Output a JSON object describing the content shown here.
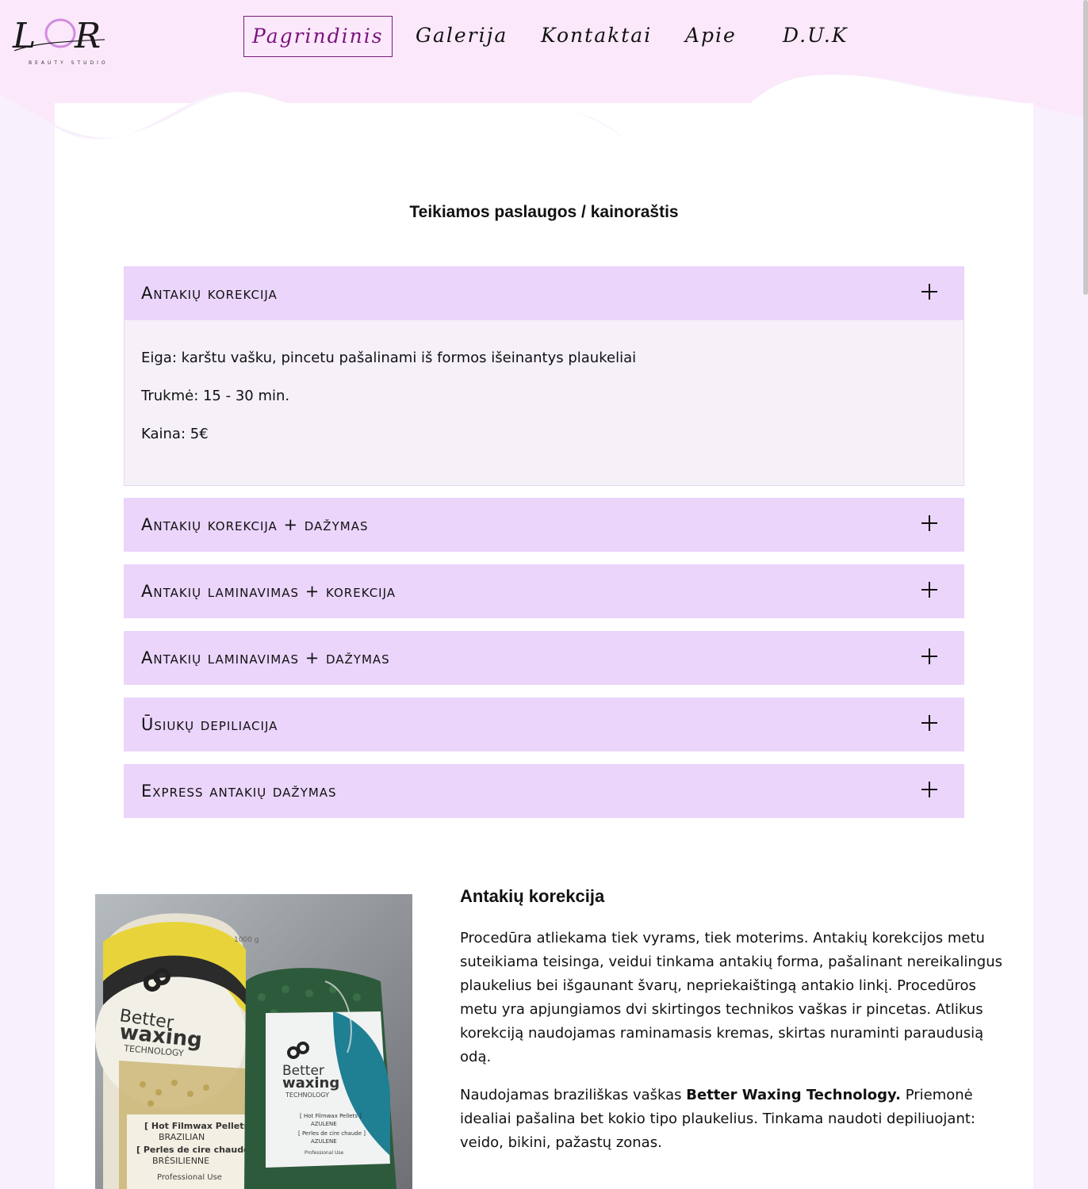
{
  "brand": {
    "logo_text": "LOR",
    "logo_sub": "BEAUTY STUDIO"
  },
  "nav": {
    "items": [
      {
        "label": "Pagrindinis",
        "active": true
      },
      {
        "label": "Galerija",
        "active": false
      },
      {
        "label": "Kontaktai",
        "active": false
      },
      {
        "label": "Apie",
        "active": false
      },
      {
        "label": "D.U.K",
        "active": false
      }
    ]
  },
  "services": {
    "title": "Teikiamos paslaugos / kainoraštis",
    "items": [
      {
        "label": "Antakių korekcija",
        "expanded": true,
        "details": [
          "Eiga: karštu vašku, pincetu pašalinami iš formos išeinantys plaukeliai",
          "Trukmė: 15 - 30 min.",
          "Kaina: 5€"
        ]
      },
      {
        "label": "Antakių korekcija + dažymas",
        "expanded": false
      },
      {
        "label": "Antakių laminavimas + korekcija",
        "expanded": false
      },
      {
        "label": "Antakių laminavimas + dažymas",
        "expanded": false
      },
      {
        "label": "Ūsiukų depiliacija",
        "expanded": false
      },
      {
        "label": "Express antakių dažymas",
        "expanded": false
      }
    ]
  },
  "article": {
    "title": "Antakių korekcija",
    "paragraph1": "Procedūra atliekama tiek vyrams, tiek moterims. Antakių korekcijos metu suteikiama teisinga, veidui tinkama antakių forma, pašalinant nereikalingus plaukelius bei išgaunant švarų, nepriekaištingą antakio linkį. Procedūros metu yra apjungiamos dvi skirtingos technikos vaškas ir pincetas. Atlikus korekciją naudojamas raminamasis kremas, skirtas nuraminti paraudusią odą.",
    "paragraph2_before": "Naudojamas braziliškas vaškas ",
    "paragraph2_bold": "Better Waxing Technology.",
    "paragraph2_after": " Priemonė idealiai pašalina bet kokio tipo plaukelius. Tinkama naudoti depiliuojant: veido, bikini, pažastų zonas.",
    "photo": {
      "bag1_brand_top": "Better",
      "bag1_brand_main": "waxing",
      "bag1_brand_sub": "TECHNOLOGY",
      "bag1_product": "[ Hot Filmwax Pellets ]",
      "bag1_variant": "BRAZILIAN",
      "bag1_fr": "[ Perles de cire chaude ]",
      "bag1_fr_variant": "BRÉSILIENNE",
      "bag1_use": "Professional Use",
      "bag1_weight": "1000 g",
      "bag2_brand_top": "Better",
      "bag2_brand_main": "waxing",
      "bag2_brand_sub": "TECHNOLOGY",
      "bag2_product": "[ Hot Filmwax Pellets ]",
      "bag2_variant": "AZULENE",
      "bag2_fr": "[ Perles de cire chaude ]",
      "bag2_fr_variant": "AZULENE",
      "bag2_use": "Professional Use"
    }
  },
  "colors": {
    "header_bg": "#fbe9fb",
    "page_bg": "#f8f0fd",
    "accordion_head": "#ebd5fb",
    "accordion_body": "#f6f0f8",
    "nav_active": "#7a137f"
  }
}
